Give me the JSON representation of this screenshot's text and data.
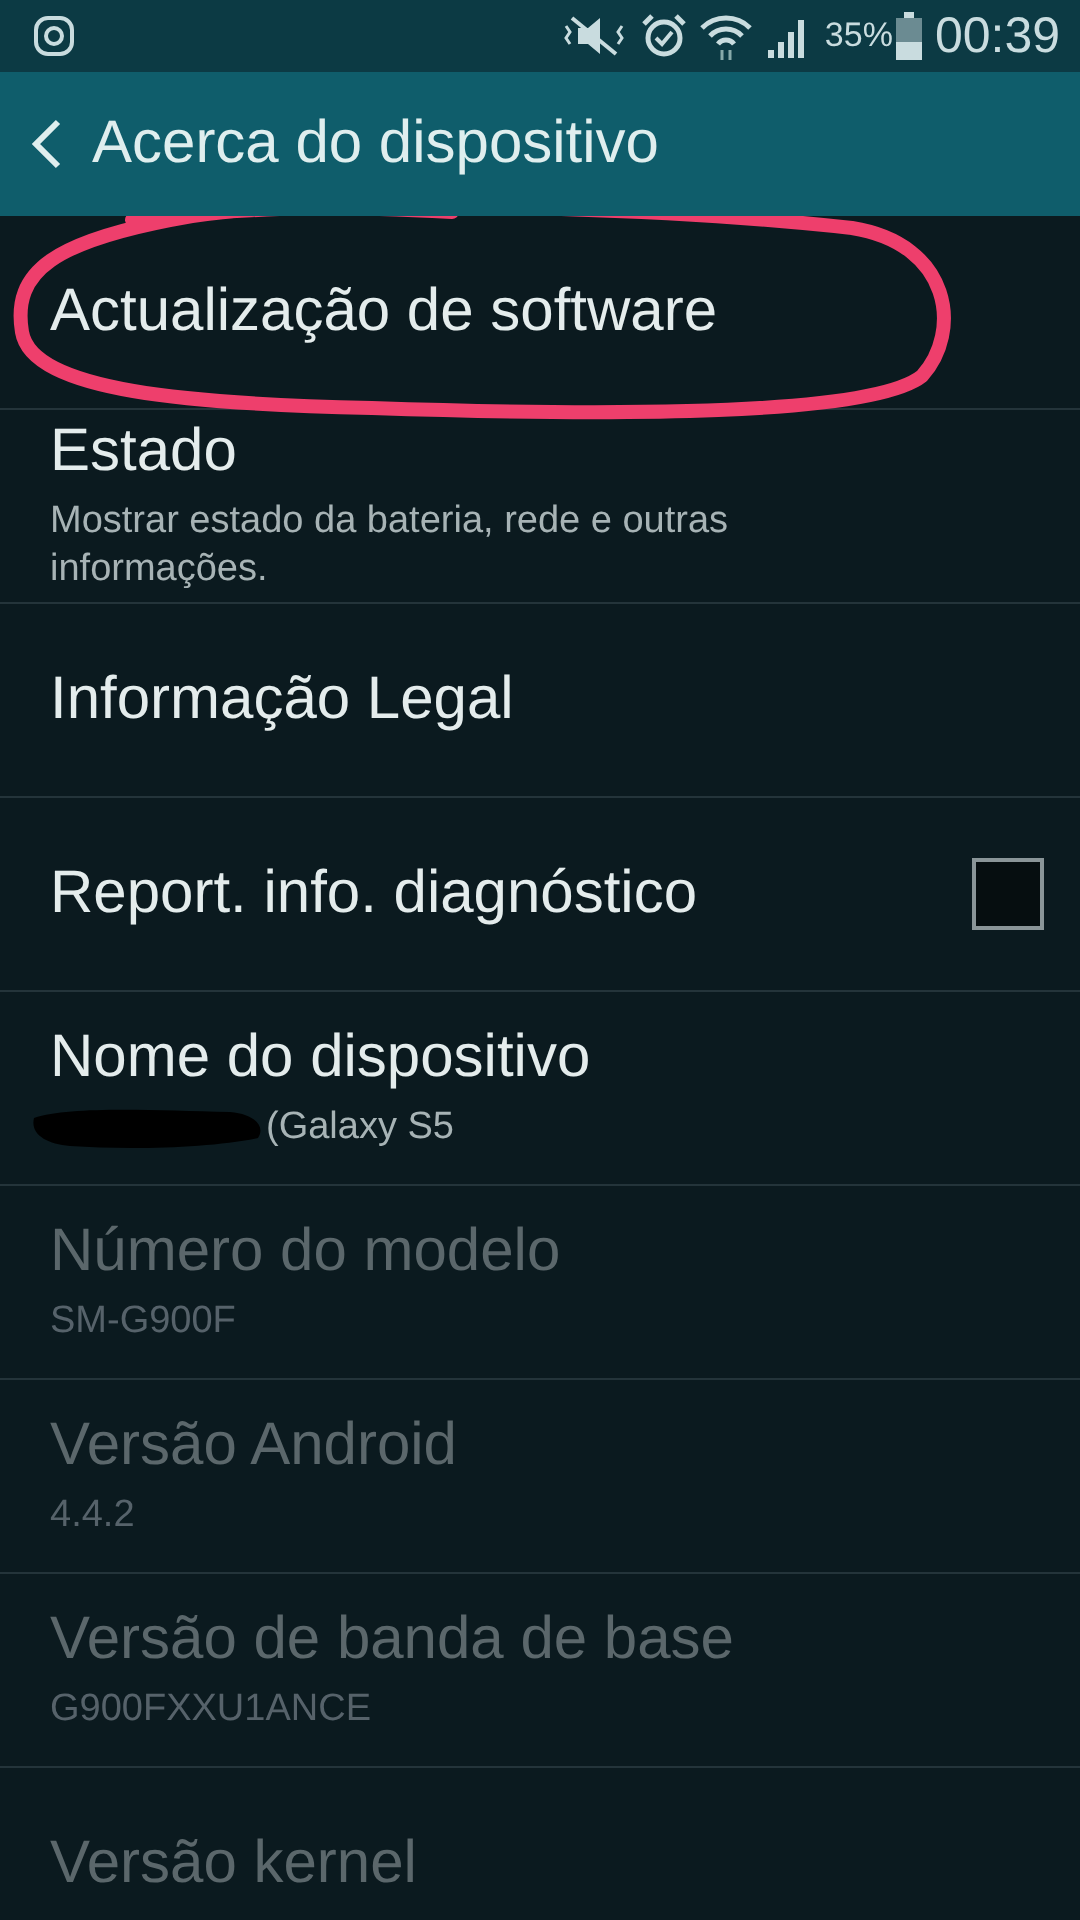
{
  "status_bar": {
    "battery_text": "35%",
    "time": "00:39"
  },
  "header": {
    "title": "Acerca do dispositivo"
  },
  "items": [
    {
      "kind": "link",
      "title": "Actualização de software",
      "disabled": false,
      "circled": true
    },
    {
      "kind": "link",
      "title": "Estado",
      "subtitle": "Mostrar estado da bateria, rede e outras informações.",
      "disabled": false,
      "circled": false
    },
    {
      "kind": "link",
      "title": "Informação Legal",
      "disabled": false,
      "circled": false
    },
    {
      "kind": "checkbox",
      "title": "Report. info. diagnóstico",
      "checked": false,
      "disabled": false,
      "circled": false
    },
    {
      "kind": "link",
      "title": "Nome do dispositivo",
      "subtitle": "(Galaxy S5",
      "redacted": true,
      "disabled": false,
      "circled": false
    },
    {
      "kind": "link",
      "title": "Número do modelo",
      "subtitle": "SM-G900F",
      "disabled": true,
      "circled": false
    },
    {
      "kind": "link",
      "title": "Versão Android",
      "subtitle": "4.4.2",
      "disabled": true,
      "circled": false
    },
    {
      "kind": "link",
      "title": "Versão de banda de base",
      "subtitle": "G900FXXU1ANCE",
      "disabled": true,
      "circled": false
    },
    {
      "kind": "link",
      "title": "Versão kernel",
      "disabled": true,
      "circled": false
    }
  ]
}
